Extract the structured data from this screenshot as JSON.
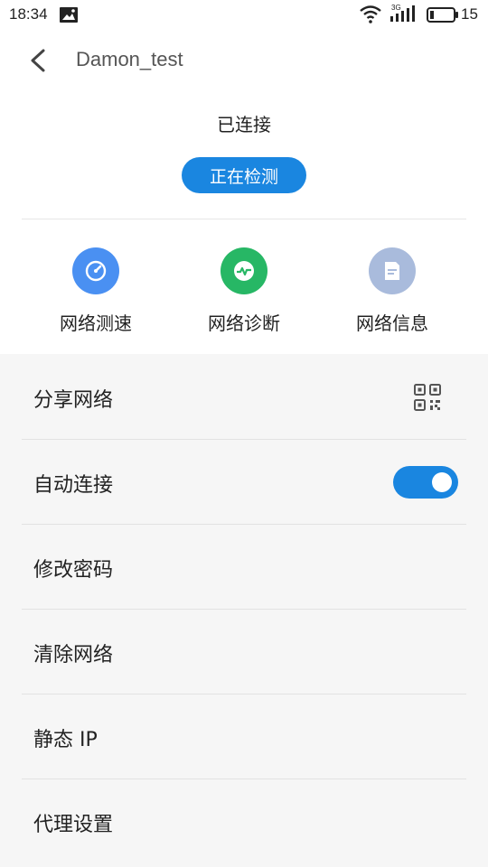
{
  "status_bar": {
    "time": "18:34",
    "network_type": "3G",
    "battery_level": "15",
    "icons": [
      "image-message-icon",
      "wifi-icon",
      "cell-signal-icon",
      "battery-icon"
    ]
  },
  "header": {
    "title": "Damon_test",
    "back_icon": "chevron-left-icon"
  },
  "connection": {
    "status_text": "已连接",
    "detect_button_label": "正在检测"
  },
  "tools": [
    {
      "label": "网络测速",
      "icon": "speedometer-icon",
      "color": "#4a90f2"
    },
    {
      "label": "网络诊断",
      "icon": "pulse-icon",
      "color": "#27b765"
    },
    {
      "label": "网络信息",
      "icon": "document-icon",
      "color": "#a9bbdc"
    }
  ],
  "settings": [
    {
      "label": "分享网络",
      "accessory": "qr-code-icon"
    },
    {
      "label": "自动连接",
      "accessory": "toggle",
      "toggle_on": true
    },
    {
      "label": "修改密码"
    },
    {
      "label": "清除网络"
    },
    {
      "label": "静态 IP"
    },
    {
      "label": "代理设置"
    }
  ],
  "colors": {
    "accent": "#1a86e0",
    "background": "#f6f6f6"
  }
}
